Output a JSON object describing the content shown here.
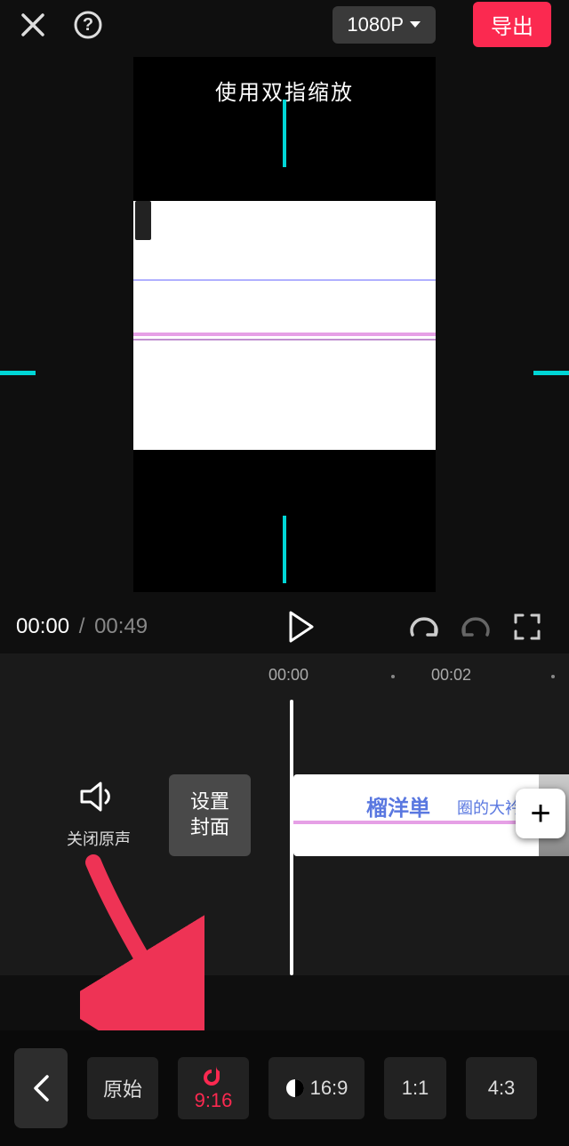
{
  "topbar": {
    "resolution": "1080P",
    "export": "导出"
  },
  "preview": {
    "hint": "使用双指缩放"
  },
  "playback": {
    "current": "00:00",
    "separator": "/",
    "duration": "00:49"
  },
  "ruler": {
    "t0": "00:00",
    "t1": "00:02"
  },
  "timeline": {
    "mute_label": "关闭原声",
    "cover_line1": "设置",
    "cover_line2": "封面",
    "clip_text": "榴洋単",
    "clip_text2": "圈的大衿単",
    "add": "+"
  },
  "ratios": {
    "original": "原始",
    "r916": "9:16",
    "r169": "16:9",
    "r11": "1:1",
    "r43": "4:3"
  }
}
